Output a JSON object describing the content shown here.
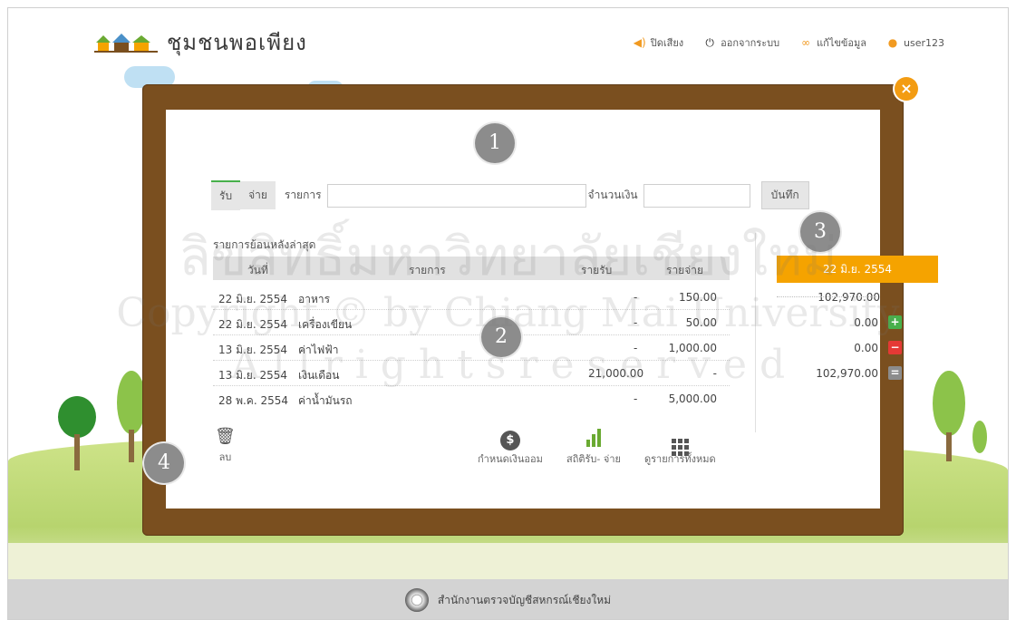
{
  "brand": {
    "name": "ชุมชนพอเพียง"
  },
  "topnav": [
    {
      "label": "ปิดเสียง",
      "icon": "speaker-icon"
    },
    {
      "label": "ออกจากระบบ",
      "icon": "power-icon"
    },
    {
      "label": "แก้ไขข้อมูล",
      "icon": "edit-profile-icon"
    },
    {
      "label": "user123",
      "icon": "user-icon"
    }
  ],
  "entry": {
    "tabs": [
      "รับ",
      "จ่าย"
    ],
    "item_label": "รายการ",
    "amount_label": "จำนวนเงิน",
    "save_label": "บันทึก",
    "item_value": "",
    "amount_value": ""
  },
  "history": {
    "title": "รายการย้อนหลังล่าสุด",
    "columns": [
      "วันที่",
      "รายการ",
      "รายรับ",
      "รายจ่าย"
    ],
    "rows": [
      {
        "date": "22 มิ.ย. 2554",
        "item": "อาหาร",
        "income": "-",
        "expense": "150.00"
      },
      {
        "date": "22 มิ.ย. 2554",
        "item": "เครื่องเขียน",
        "income": "-",
        "expense": "50.00"
      },
      {
        "date": "13 มิ.ย. 2554",
        "item": "ค่าไฟฟ้า",
        "income": "-",
        "expense": "1,000.00"
      },
      {
        "date": "13 มิ.ย. 2554",
        "item": "เงินเดือน",
        "income": "21,000.00",
        "expense": "-"
      },
      {
        "date": "28 พ.ค. 2554",
        "item": "ค่าน้ำมันรถ",
        "income": "-",
        "expense": "5,000.00"
      }
    ]
  },
  "summary": {
    "date": "22 มิ.ย. 2554",
    "balance": "102,970.00",
    "income_total": "0.00",
    "expense_total": "0.00",
    "net": "102,970.00"
  },
  "toolbar": {
    "delete_label": "ลบ",
    "savings_label": "กำหนดเงินออม",
    "stats_label": "สถิติรับ- จ่าย",
    "all_label": "ดูรายการทั้งหมด"
  },
  "markers": [
    "1",
    "2",
    "3",
    "4"
  ],
  "footer": {
    "org": "สำนักงานตรวจบัญชีสหกรณ์เชียงใหม่"
  },
  "watermarks": [
    "ลิขสิทธิ์มหาวิทยาลัยเชียงใหม่",
    "Copyright © by Chiang Mai University",
    "A l l   r i g h t s   r e s e r v e d"
  ],
  "colors": {
    "accent": "#f5a300",
    "frame": "#7a4f1f",
    "green": "#47b04b",
    "red": "#e53935"
  }
}
